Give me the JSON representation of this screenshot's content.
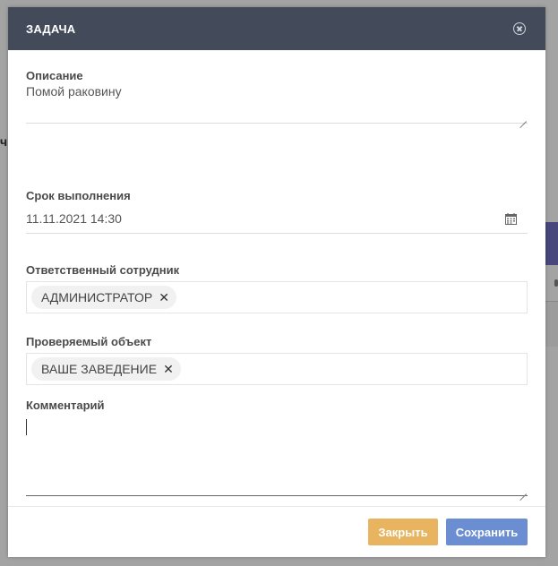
{
  "background": {
    "left_fragment": "ч"
  },
  "modal": {
    "title": "ЗАДАЧА",
    "fields": {
      "description": {
        "label": "Описание",
        "value": "Помой раковину"
      },
      "deadline": {
        "label": "Срок выполнения",
        "value": "11.11.2021 14:30"
      },
      "responsible": {
        "label": "Ответственный сотрудник",
        "tag": "АДМИНИСТРАТОР"
      },
      "object": {
        "label": "Проверяемый объект",
        "tag": "ВАШЕ ЗАВЕДЕНИЕ"
      },
      "comment": {
        "label": "Комментарий",
        "value": ""
      }
    },
    "footer": {
      "close_label": "Закрыть",
      "save_label": "Сохранить"
    },
    "colors": {
      "header": "#434b5b",
      "close_button": "#e8b45f",
      "save_button": "#6a8ed1"
    },
    "icons": {
      "close": "close-circle-icon",
      "calendar": "calendar-icon",
      "remove_tag": "remove-tag-icon"
    }
  }
}
